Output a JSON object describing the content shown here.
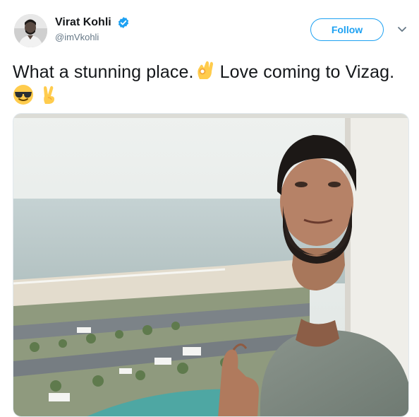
{
  "user": {
    "display_name": "Virat Kohli",
    "handle": "@imVkohli",
    "verified": true
  },
  "actions": {
    "follow_label": "Follow"
  },
  "tweet": {
    "text_part1": "What a stunning place.",
    "text_part2": " Love coming to Vizag. "
  },
  "icons": {
    "verified": "verified-badge-icon",
    "caret": "chevron-down-icon",
    "emojis": [
      "ok-hand-emoji",
      "sunglasses-emoji",
      "victory-hand-emoji"
    ]
  },
  "colors": {
    "accent": "#1da1f2",
    "text": "#14171a",
    "secondary": "#657786"
  }
}
